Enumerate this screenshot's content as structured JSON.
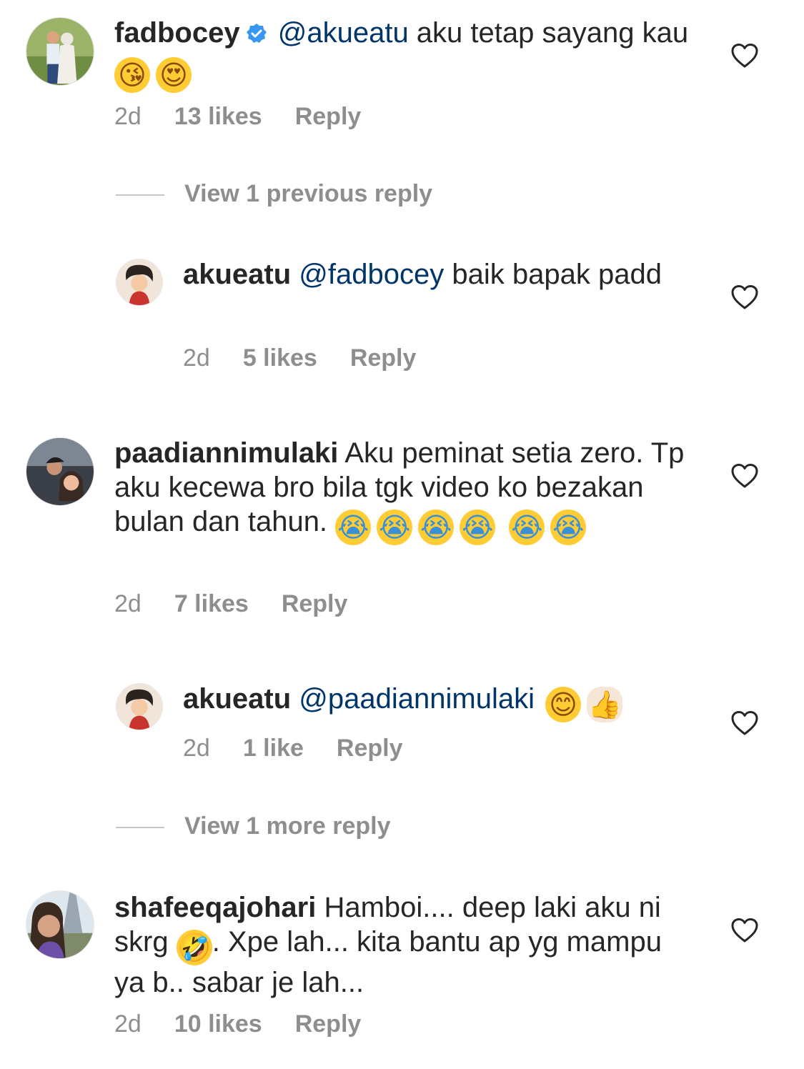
{
  "comments": [
    {
      "username": "fadbocey",
      "verified": true,
      "mention": "@akueatu",
      "text": " aku tetap sayang kau",
      "emojis": [
        "😘",
        "😍"
      ],
      "time": "2d",
      "likes": "13 likes",
      "reply_label": "Reply"
    },
    {
      "view_label": "View 1 previous reply"
    },
    {
      "username": "akueatu",
      "mention": "@fadbocey",
      "text": " baik bapak padd",
      "time": "2d",
      "likes": "5 likes",
      "reply_label": "Reply"
    },
    {
      "username": "paadiannimulaki",
      "text": "Aku peminat setia zero. Tp aku kecewa bro bila tgk video ko bezakan bulan dan tahun.",
      "emojis": [
        "😭",
        "😭",
        "😭",
        "😭",
        "😭",
        "😭"
      ],
      "time": "2d",
      "likes": "7 likes",
      "reply_label": "Reply"
    },
    {
      "username": "akueatu",
      "mention": "@paadiannimulaki",
      "emojis": [
        "😊",
        "👍"
      ],
      "time": "2d",
      "likes": "1 like",
      "reply_label": "Reply"
    },
    {
      "view_label": "View 1 more reply"
    },
    {
      "username": "shafeeqajohari",
      "text_a": "Hamboi.... deep laki aku ni skrg",
      "emoji": "🤣",
      "text_b": ". Xpe lah... kita bantu ap yg mampu ya b.. sabar je lah...",
      "time": "2d",
      "likes": "10 likes",
      "reply_label": "Reply"
    }
  ],
  "colors": {
    "text": "#262626",
    "mention": "#003569",
    "meta": "#8e8e8e",
    "verified": "#3897f0"
  },
  "icons": {
    "like": "heart-outline-icon",
    "verified": "verified-badge-icon"
  }
}
